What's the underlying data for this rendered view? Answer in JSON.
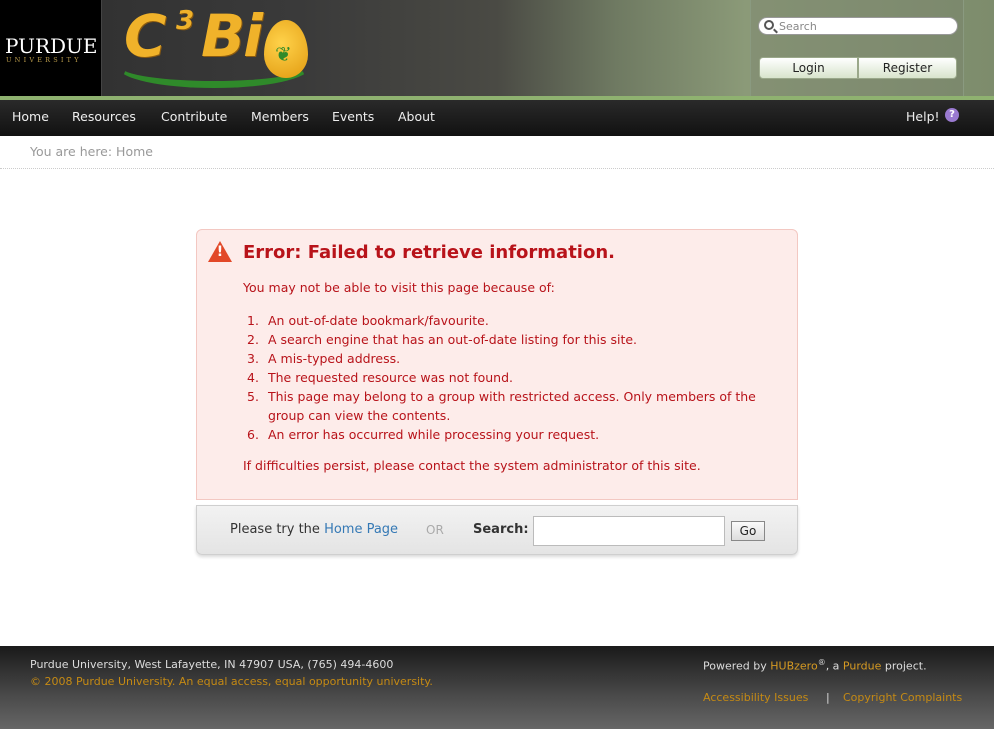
{
  "header": {
    "purdue_name": "PURDUE",
    "purdue_sub": "UNIVERSITY",
    "logo_text": "C",
    "logo_sup": "3",
    "logo_rest": "Bi",
    "search_placeholder": "Search",
    "login_label": "Login",
    "register_label": "Register"
  },
  "nav": {
    "items": [
      "Home",
      "Resources",
      "Contribute",
      "Members",
      "Events",
      "About"
    ],
    "help_label": "Help!",
    "help_icon": "?"
  },
  "breadcrumb": {
    "label": "You are here: Home"
  },
  "error": {
    "title": "Error: Failed to retrieve information.",
    "intro": "You may not be able to visit this page because of:",
    "reasons": [
      "An out-of-date bookmark/favourite.",
      "A search engine that has an out-of-date listing for this site.",
      "A mis-typed address.",
      "The requested resource was not found.",
      "This page may belong to a group with restricted access. Only members of the group can view the contents.",
      "An error has occurred while processing your request."
    ],
    "footer": "If difficulties persist, please contact the system administrator of this site."
  },
  "try": {
    "prefix": "Please try the ",
    "link": "Home Page",
    "or": "OR",
    "search_label": "Search:",
    "go_label": "Go"
  },
  "footer": {
    "address": "Purdue University, West Lafayette, IN 47907 USA, (765) 494-4600",
    "copyright": "© 2008 Purdue University. An equal access, equal opportunity university.",
    "powered_prefix": "Powered by ",
    "hubzero": "HUBzero",
    "reg": "®",
    "a": ", a ",
    "purdue": "Purdue",
    "project": " project.",
    "accessibility": "Accessibility Issues",
    "sep": "|",
    "copyright_complaints": "Copyright Complaints"
  },
  "colors": {
    "error_text": "#b8131a",
    "error_bg": "#fdecea",
    "link": "#3579b5",
    "footer_link": "#c58a14",
    "nav_accent": "#8fb270"
  }
}
